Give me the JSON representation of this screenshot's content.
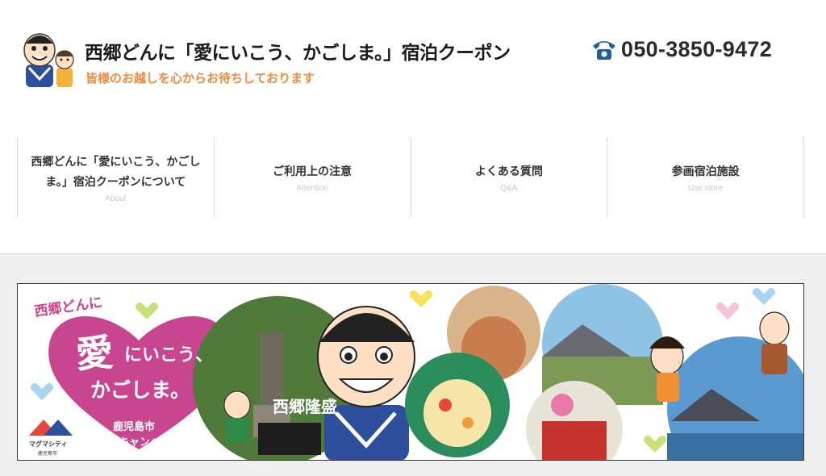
{
  "header": {
    "title": "西郷どんに「愛にいこう、かごしま。」宿泊クーポン",
    "tagline": "皆様のお越しを心からお待ちしております",
    "phone_icon": "phone-icon",
    "phone_number": "050-3850-9472",
    "tagline_color": "#ee8a3c"
  },
  "nav": {
    "items": [
      {
        "label": "西郷どんに「愛にいこう、かごしま。」宿泊クーポンについて",
        "sub": "About"
      },
      {
        "label": "ご利用上の注意",
        "sub": "Attention"
      },
      {
        "label": "よくある質問",
        "sub": "Q&A"
      },
      {
        "label": "参画宿泊施設",
        "sub": "Use store"
      }
    ]
  },
  "banner": {
    "script_title": "西郷どんに",
    "heart_big": "愛",
    "heart_line1": "にいこう、",
    "heart_line2": "かごしま。",
    "city": "鹿児島市",
    "campaign": "宿泊キャンペーン",
    "logo_name": "マグマシティ",
    "logo_sub": "鹿児島市",
    "years_badge": "西郷隆盛",
    "accent_color": "#c8458f"
  }
}
